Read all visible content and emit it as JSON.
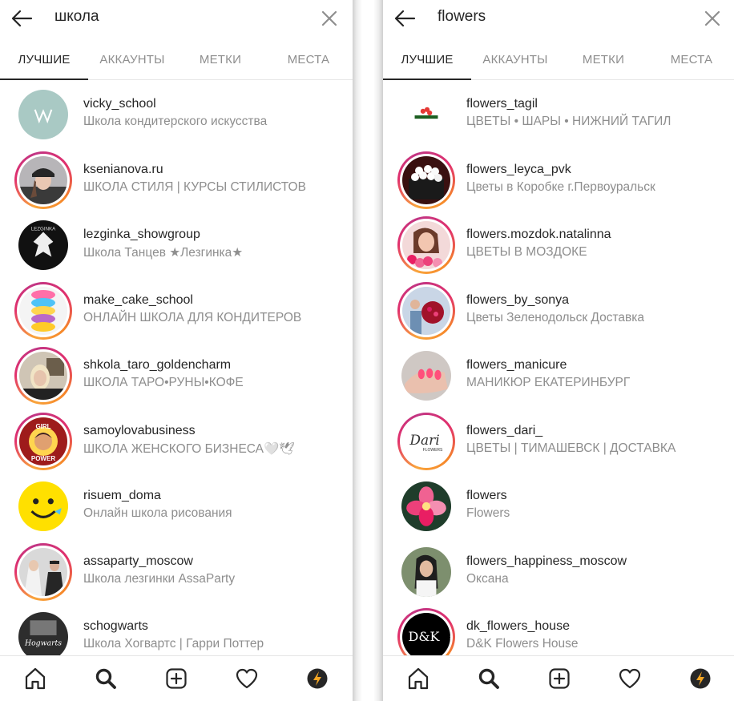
{
  "left": {
    "search": {
      "query": "школа"
    },
    "tabs": [
      {
        "label": "ЛУЧШИЕ",
        "active": true
      },
      {
        "label": "АККАУНТЫ",
        "active": false
      },
      {
        "label": "МЕТКИ",
        "active": false
      },
      {
        "label": "МЕСТА",
        "active": false
      }
    ],
    "results": [
      {
        "username": "vicky_school",
        "subtitle": "Школа кондитерского искусства",
        "ring": false,
        "avatar": "mint-logo"
      },
      {
        "username": "ksenianova.ru",
        "subtitle": "ШКОЛА СТИЛЯ | КУРСЫ СТИЛИСТОВ",
        "ring": true,
        "avatar": "woman-cap"
      },
      {
        "username": "lezginka_showgroup",
        "subtitle": "Школа Танцев ★Лезгинка★",
        "ring": false,
        "avatar": "black-emblem"
      },
      {
        "username": "make_cake_school",
        "subtitle": "ОНЛАЙН ШКОЛА ДЛЯ КОНДИТЕРОВ",
        "ring": true,
        "avatar": "macarons"
      },
      {
        "username": "shkola_taro_goldencharm",
        "subtitle": "ШКОЛА ТАРО•РУНЫ•КОФЕ",
        "ring": true,
        "avatar": "blonde-woman"
      },
      {
        "username": "samoylovabusiness",
        "subtitle": "ШКОЛА ЖЕНСКОГО БИЗНЕСА🤍🕊",
        "ring": true,
        "avatar": "girl-power"
      },
      {
        "username": "risuem_doma",
        "subtitle": "Онлайн школа рисования",
        "ring": false,
        "avatar": "smiley"
      },
      {
        "username": "assaparty_moscow",
        "subtitle": "Школа лезгинки AssaParty",
        "ring": true,
        "avatar": "dancers"
      },
      {
        "username": "schogwarts",
        "subtitle": "Школа Хогвартс | Гарри Поттер",
        "ring": false,
        "avatar": "hogwarts"
      }
    ]
  },
  "right": {
    "search": {
      "query": "flowers"
    },
    "tabs": [
      {
        "label": "ЛУЧШИЕ",
        "active": true
      },
      {
        "label": "АККАУНТЫ",
        "active": false
      },
      {
        "label": "МЕТКИ",
        "active": false
      },
      {
        "label": "МЕСТА",
        "active": false
      }
    ],
    "results": [
      {
        "username": "flowers_tagil",
        "subtitle": "ЦВЕТЫ • ШАРЫ • НИЖНИЙ ТАГИЛ",
        "ring": false,
        "avatar": "tagil-logo"
      },
      {
        "username": "flowers_leyca_pvk",
        "subtitle": "Цветы в Коробке г.Первоуральск",
        "ring": true,
        "avatar": "flower-box"
      },
      {
        "username": "flowers.mozdok.natalinna",
        "subtitle": "ЦВЕТЫ В МОЗДОКЕ",
        "ring": true,
        "avatar": "woman-tulips"
      },
      {
        "username": "flowers_by_sonya",
        "subtitle": "Цветы Зеленодольск Доставка",
        "ring": true,
        "avatar": "bouquet-person"
      },
      {
        "username": "flowers_manicure",
        "subtitle": "МАНИКЮР ЕКАТЕРИНБУРГ",
        "ring": false,
        "avatar": "manicure"
      },
      {
        "username": "flowers_dari_",
        "subtitle": "ЦВЕТЫ | ТИМАШЕВСК | ДОСТАВКА",
        "ring": true,
        "avatar": "dari-logo"
      },
      {
        "username": "flowers",
        "subtitle": "Flowers",
        "ring": false,
        "avatar": "pink-flower"
      },
      {
        "username": "flowers_happiness_moscow",
        "subtitle": "Оксана",
        "ring": false,
        "avatar": "woman-dark"
      },
      {
        "username": "dk_flowers_house",
        "subtitle": "D&K Flowers House",
        "ring": true,
        "avatar": "dk-logo"
      }
    ]
  },
  "avatar_text": {
    "lezginka": "LEZGINKA",
    "girl": "GIRL",
    "power": "POWER",
    "hogwarts": "Hogwarts",
    "dari_script": "Dari",
    "dari_small": "FLOWERS",
    "dk": "D&K",
    "dk_small": "FLOWERS HOUSE"
  },
  "colors": {
    "text_primary": "#262626",
    "text_secondary": "#8e8e8e",
    "ring_gradient": [
      "#f9a43b",
      "#e1306c",
      "#c13584"
    ],
    "divider": "#e6e6e6"
  },
  "bottom_nav": [
    "home-icon",
    "search-icon",
    "new-post-icon",
    "activity-heart-icon",
    "profile-avatar-icon"
  ]
}
